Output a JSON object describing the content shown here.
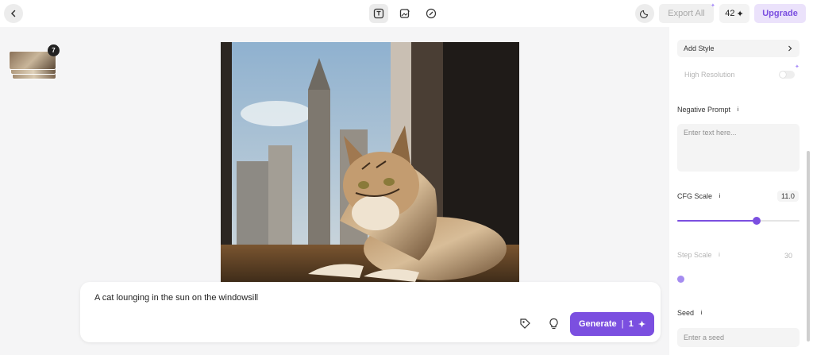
{
  "header": {
    "export_label": "Export All",
    "credits_value": "42",
    "credits_symbol": "✦",
    "upgrade_label": "Upgrade"
  },
  "gallery": {
    "count": "7"
  },
  "prompt": {
    "text": "A cat lounging in the sun on the windowsill",
    "generate_label": "Generate",
    "generate_cost": "1",
    "generate_symbol": "✦"
  },
  "settings": {
    "add_style_label": "Add Style",
    "high_resolution_label": "High Resolution",
    "negative_prompt_label": "Negative Prompt",
    "negative_prompt_placeholder": "Enter text here...",
    "cfg_scale_label": "CFG Scale",
    "cfg_scale_value": "11.0",
    "cfg_scale_fraction": 0.65,
    "step_scale_label": "Step Scale",
    "step_scale_value": "30",
    "seed_label": "Seed",
    "seed_placeholder": "Enter a seed"
  },
  "colors": {
    "accent": "#7b4fe0",
    "accent_light": "#ebe2fb"
  }
}
